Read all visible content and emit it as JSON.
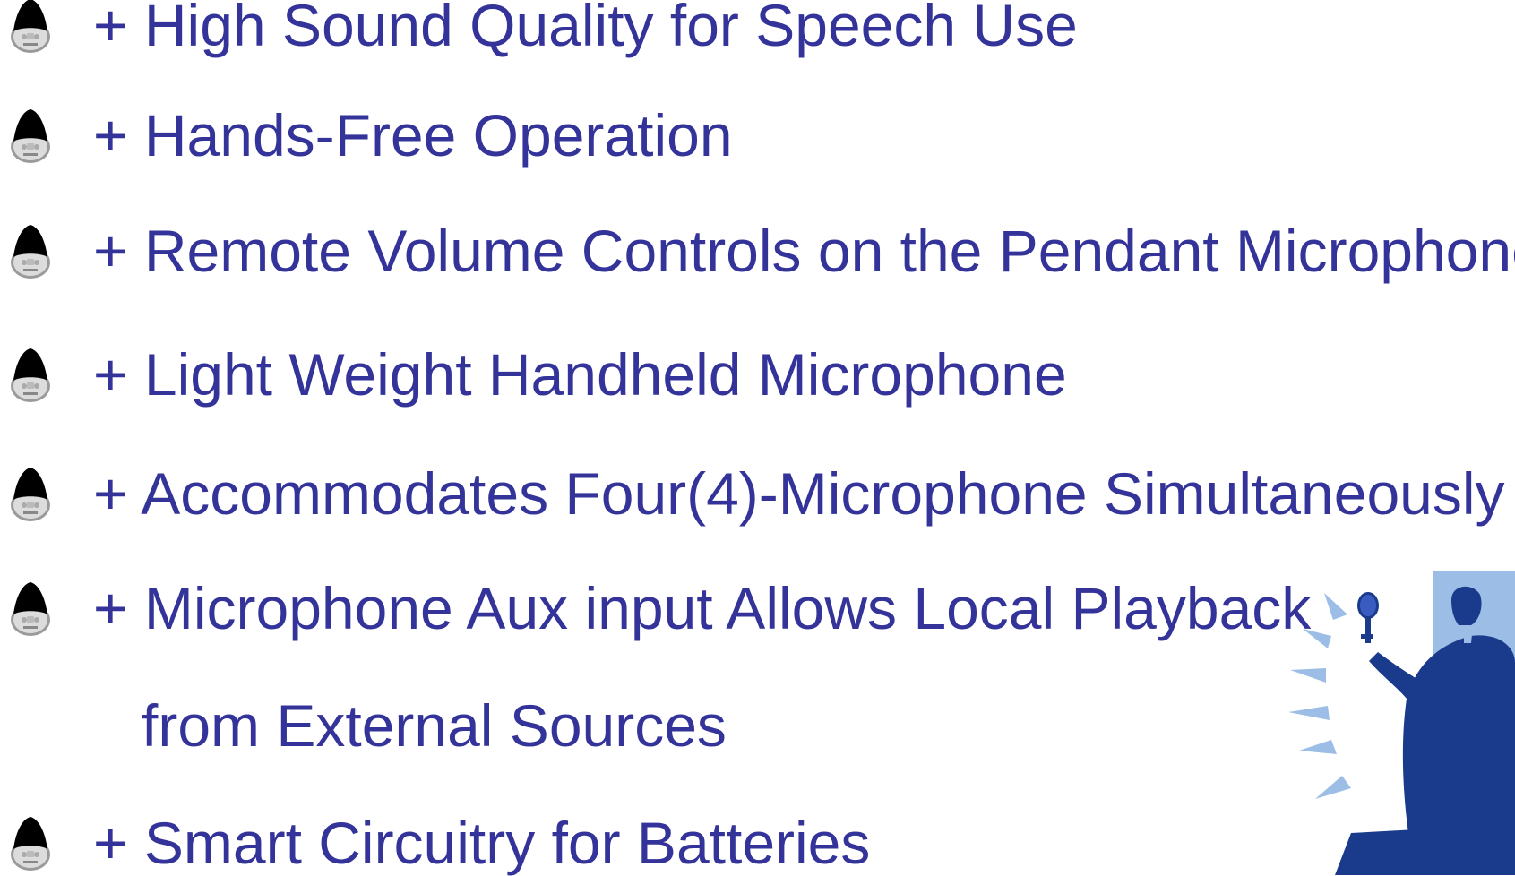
{
  "items": [
    {
      "text": "+ High Sound Quality for Speech Use"
    },
    {
      "text": "+ Hands-Free Operation"
    },
    {
      "text": "+ Remote Volume Controls on the Pendant Microphone"
    },
    {
      "text": "+ Light Weight Handheld Microphone"
    },
    {
      "text": "+ Accommodates Four(4)-Microphone Simultaneously"
    },
    {
      "text": "+ Microphone Aux input Allows Local Playback"
    },
    {
      "text": "from External Sources"
    },
    {
      "text": "+ Smart Circuitry for Batteries"
    }
  ],
  "bullet_icon": "pendant-microphone-icon",
  "clipart": "speaker-with-microphone-illustration",
  "colors": {
    "text": "#33339a",
    "clipart_dark": "#1a3a8c",
    "clipart_light": "#9bbde6"
  }
}
